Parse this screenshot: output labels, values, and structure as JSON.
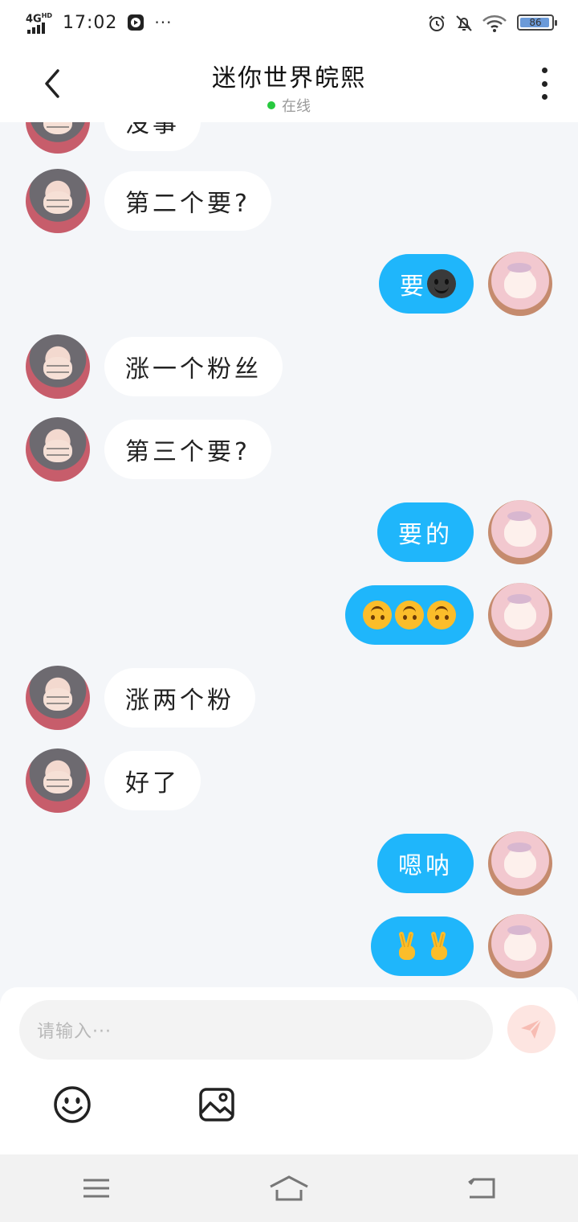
{
  "status_bar": {
    "network": "4G",
    "network_sup": "HD",
    "time": "17:02",
    "more": "···",
    "battery": "86"
  },
  "header": {
    "title": "迷你世界皖熙",
    "status": "在线",
    "status_color": "#27c93f"
  },
  "messages": [
    {
      "from": "other",
      "text": "没事"
    },
    {
      "from": "other",
      "text": "第二个要?"
    },
    {
      "from": "self",
      "text": "要",
      "emoji": [
        "dark-smiley"
      ]
    },
    {
      "from": "other",
      "text": "涨一个粉丝"
    },
    {
      "from": "other",
      "text": "第三个要?"
    },
    {
      "from": "self",
      "text": "要的"
    },
    {
      "from": "self",
      "text": "",
      "emoji": [
        "upside-down-face",
        "upside-down-face",
        "upside-down-face"
      ]
    },
    {
      "from": "other",
      "text": "涨两个粉"
    },
    {
      "from": "other",
      "text": "好了"
    },
    {
      "from": "self",
      "text": "嗯呐"
    },
    {
      "from": "self",
      "text": "",
      "emoji": [
        "victory-hand",
        "victory-hand"
      ]
    }
  ],
  "composer": {
    "placeholder": "请输入···",
    "send_icon": "send-icon",
    "tools": [
      "emoji-icon",
      "image-icon"
    ]
  },
  "colors": {
    "self_bubble": "#1fb6fb",
    "other_bubble": "#ffffff",
    "background": "#f4f6f9"
  },
  "navbar": {
    "icons": [
      "menu-icon",
      "home-icon",
      "back-icon"
    ]
  }
}
